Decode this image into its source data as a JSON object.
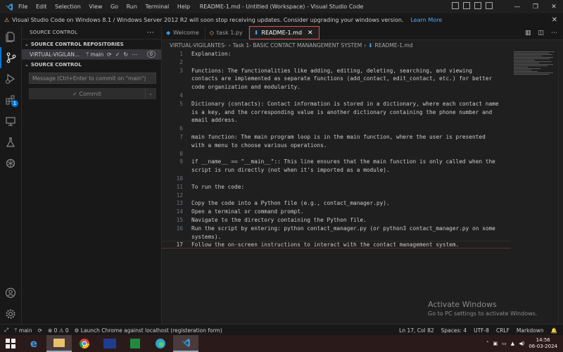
{
  "titlebar": {
    "menu": [
      "File",
      "Edit",
      "Selection",
      "View",
      "Go",
      "Run",
      "Terminal",
      "Help"
    ],
    "title": "README-1.md - Untitled (Workspace) - Visual Studio Code"
  },
  "notice": {
    "text": "Visual Studio Code on Windows 8.1 / Windows Server 2012 R2 will soon stop receiving updates. Consider upgrading your windows version.",
    "link": "Learn More"
  },
  "activity": {
    "badge": "1"
  },
  "sidebar": {
    "header": "SOURCE CONTROL",
    "repos_section": "SOURCE CONTROL REPOSITORIES",
    "repo_name": "VIRTUAL-VIGILAN...",
    "repo_branch": "main",
    "repo_count": "0",
    "sc_section": "SOURCE CONTROL",
    "message_placeholder": "Message (Ctrl+Enter to commit on \"main\")",
    "commit_label": "✓ Commit"
  },
  "tabs": [
    {
      "label": "Welcome",
      "active": false
    },
    {
      "label": "task 1.py",
      "active": false
    },
    {
      "label": "README-1.md",
      "active": true
    }
  ],
  "breadcrumbs": [
    "VIRTUAL-VIGILANTES-",
    "Task 1- BASIC CONTACT MANANGEMENT SYSTEM",
    "README-1.md"
  ],
  "editor": {
    "current_line": 17,
    "rows": [
      {
        "n": "1",
        "text": "Explanation:"
      },
      {
        "n": "2",
        "text": ""
      },
      {
        "n": "3",
        "text": "Functions: The functionalities like adding, editing, deleting, searching, and viewing"
      },
      {
        "n": "",
        "text": "contacts are implemented as separate functions (add_contact, edit_contact, etc.) for better"
      },
      {
        "n": "",
        "text": "code organization and modularity."
      },
      {
        "n": "4",
        "text": ""
      },
      {
        "n": "5",
        "text": "Dictionary (contacts): Contact information is stored in a dictionary, where each contact name"
      },
      {
        "n": "",
        "text": "is a key, and the corresponding value is another dictionary containing the phone number and"
      },
      {
        "n": "",
        "text": "email address."
      },
      {
        "n": "6",
        "text": ""
      },
      {
        "n": "7",
        "text": "main function: The main program loop is in the main function, where the user is presented"
      },
      {
        "n": "",
        "text": "with a menu to choose various operations."
      },
      {
        "n": "8",
        "text": ""
      },
      {
        "n": "9",
        "text": "if __name__ == \"__main__\":: This line ensures that the main function is only called when the"
      },
      {
        "n": "",
        "text": "script is run directly (not when it's imported as a module)."
      },
      {
        "n": "10",
        "text": ""
      },
      {
        "n": "11",
        "text": "To run the code:"
      },
      {
        "n": "12",
        "text": ""
      },
      {
        "n": "13",
        "text": "Copy the code into a Python file (e.g., contact_manager.py)."
      },
      {
        "n": "14",
        "text": "Open a terminal or command prompt."
      },
      {
        "n": "15",
        "text": "Navigate to the directory containing the Python file."
      },
      {
        "n": "16",
        "text": "Run the script by entering: python contact_manager.py (or python3 contact_manager.py on some"
      },
      {
        "n": "",
        "text": "systems)."
      },
      {
        "n": "17",
        "text": "Follow the on-screen instructions to interact with the contact management system."
      }
    ]
  },
  "watermark": {
    "title": "Activate Windows",
    "subtitle": "Go to PC settings to activate Windows."
  },
  "statusbar": {
    "branch": "main",
    "problems": "⊗ 0 ⚠ 0",
    "launch": "Launch Chrome against localhost (registeration form)",
    "position": "Ln 17, Col 82",
    "spaces": "Spaces: 4",
    "encoding": "UTF-8",
    "eol": "CRLF",
    "language": "Markdown"
  },
  "taskbar": {
    "time": "14:56",
    "date": "06-03-2024"
  },
  "colors": {
    "accent": "#0078d4",
    "active_tab_border": "#e05252",
    "taskbar": "#2b1a1a"
  }
}
